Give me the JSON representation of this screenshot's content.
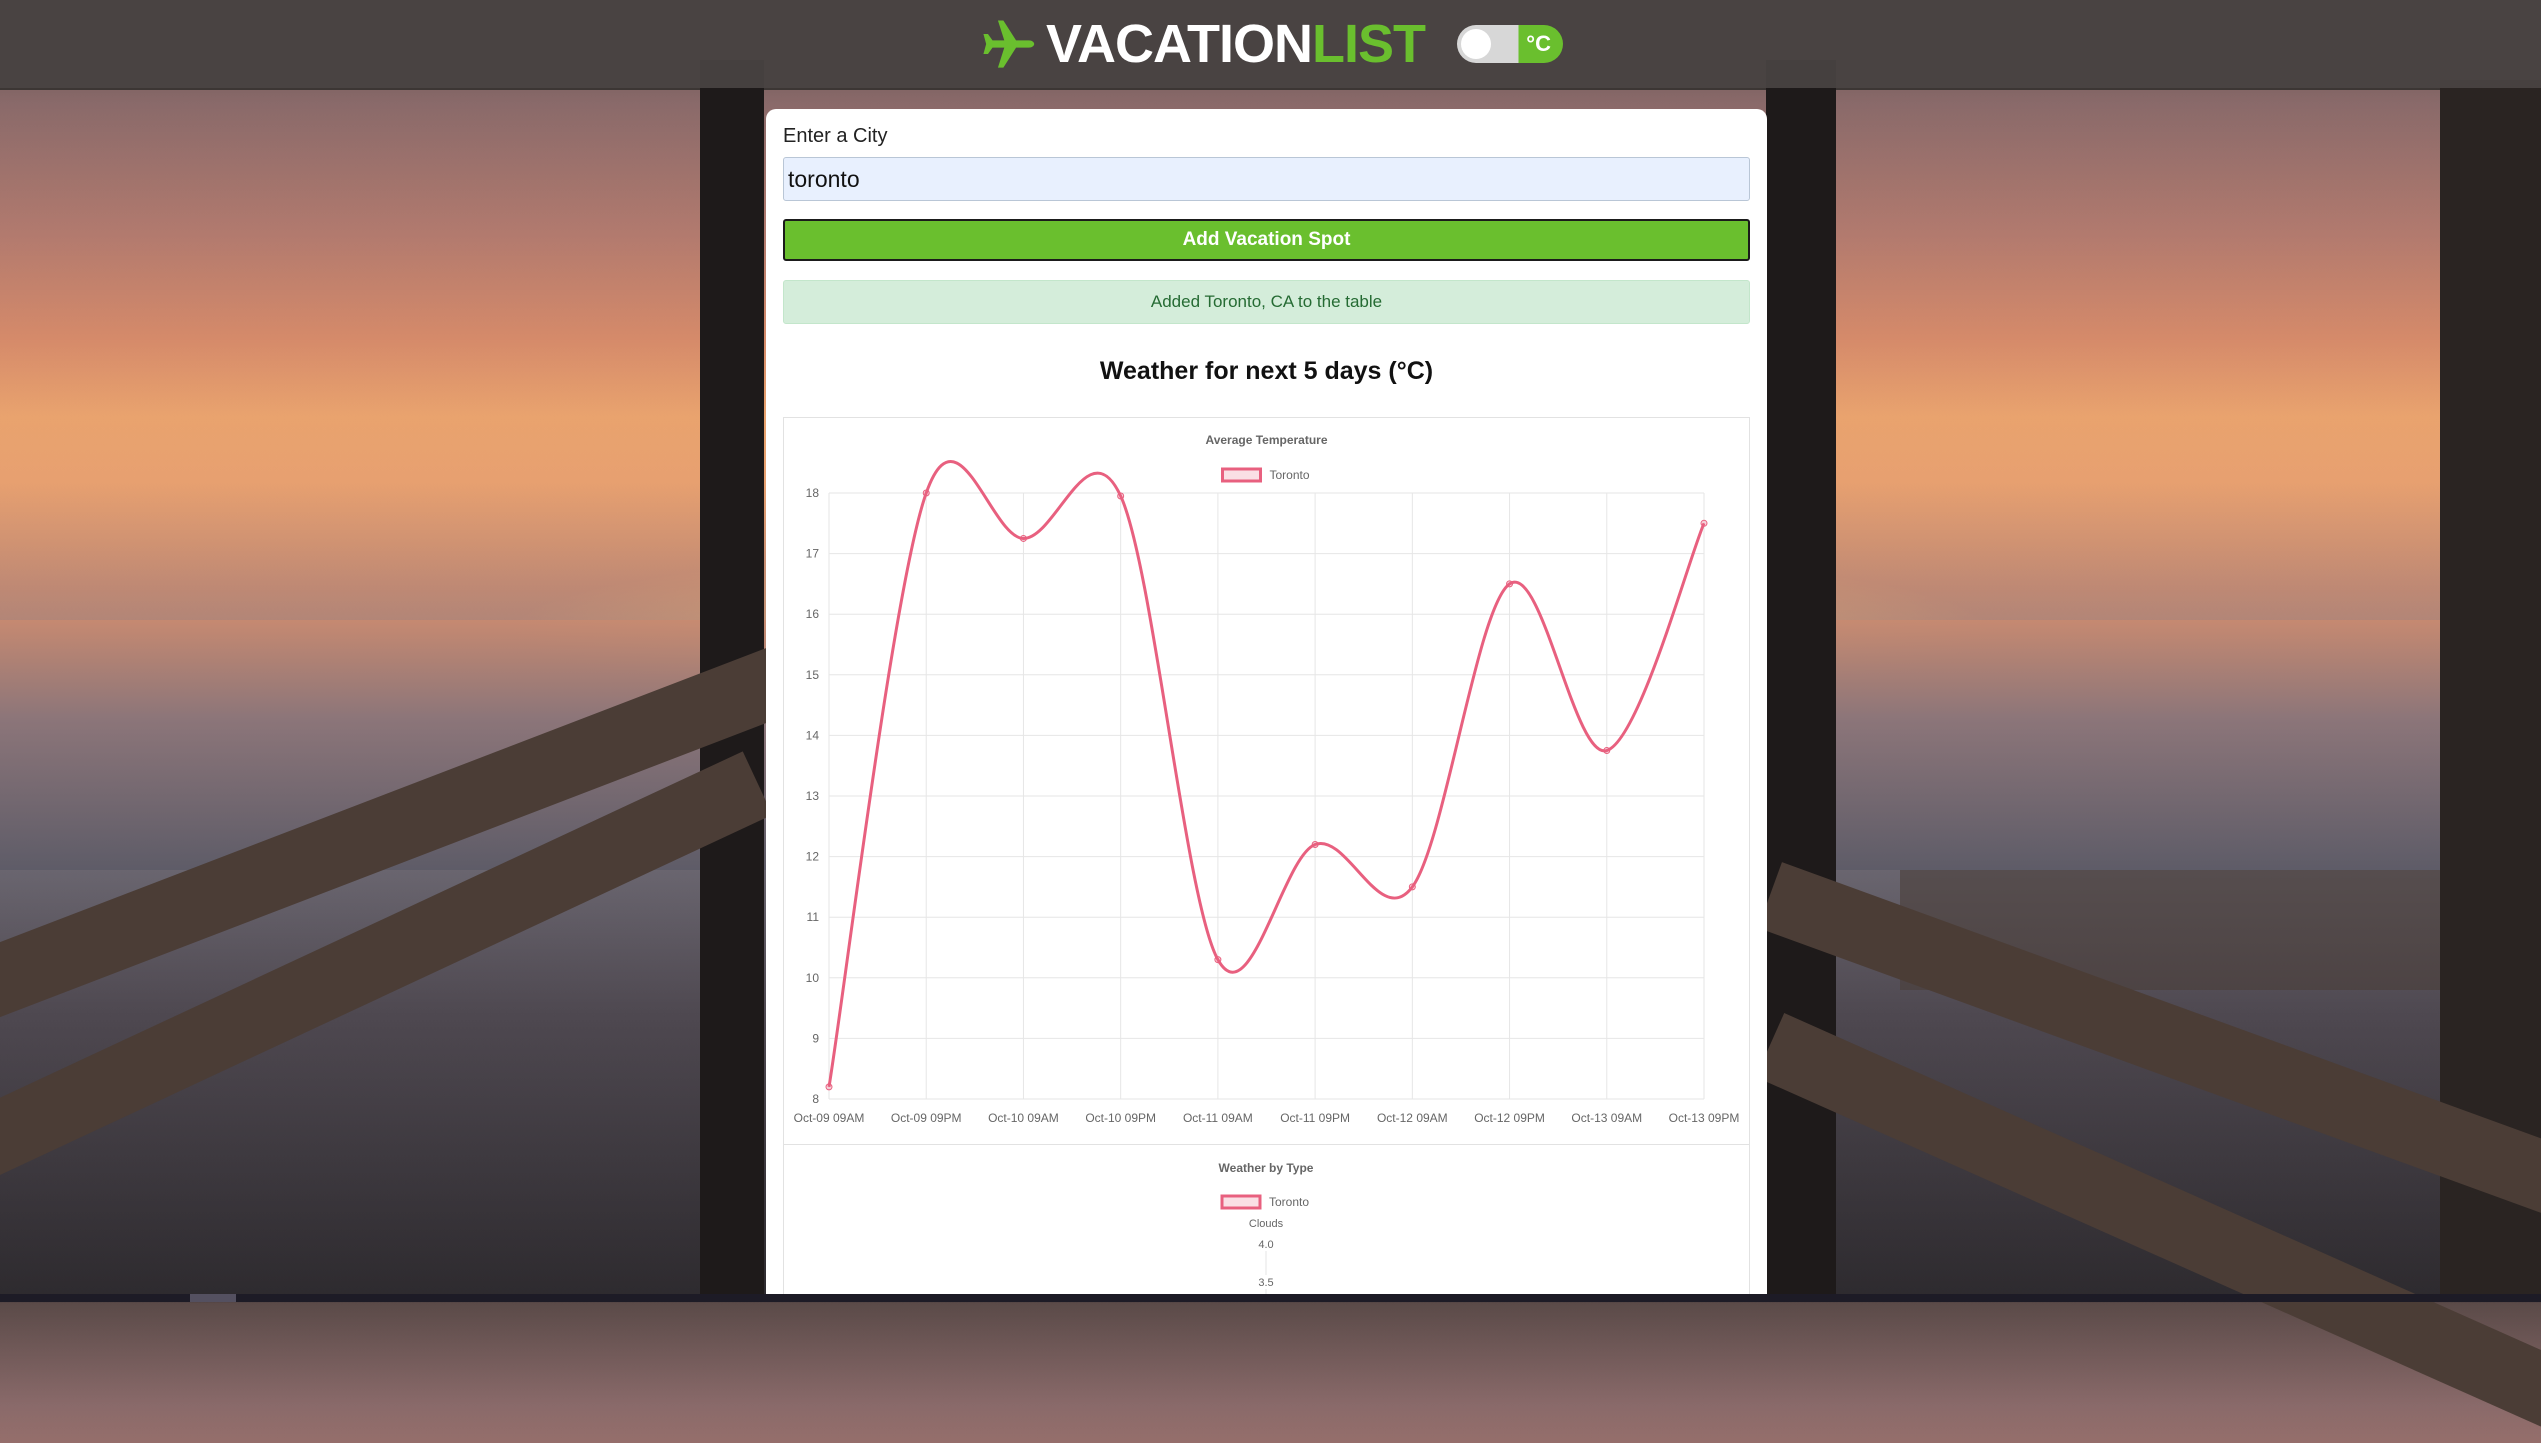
{
  "header": {
    "brand_main": "VACATION",
    "brand_accent": "LIST",
    "unit_toggle_label": "°C",
    "accent_color": "#6abf2e"
  },
  "form": {
    "city_label": "Enter a City",
    "city_value": "toronto",
    "add_button_label": "Add Vacation Spot",
    "status_message": "Added Toronto, CA to the table"
  },
  "weather": {
    "section_title": "Weather for next 5 days (°C)"
  },
  "chart_data": [
    {
      "type": "line",
      "title": "Average Temperature",
      "legend_position": "top",
      "grid": true,
      "xlabel": "",
      "ylabel": "",
      "ylim": [
        8,
        18
      ],
      "yticks": [
        8,
        9,
        10,
        11,
        12,
        13,
        14,
        15,
        16,
        17,
        18
      ],
      "x_tick_labels": [
        "Oct-09 09AM",
        "Oct-09 09PM",
        "Oct-10 09AM",
        "Oct-10 09PM",
        "Oct-11 09AM",
        "Oct-11 09PM",
        "Oct-12 09AM",
        "Oct-12 09PM",
        "Oct-13 09AM",
        "Oct-13 09PM"
      ],
      "series": [
        {
          "name": "Toronto",
          "color": "#e8607f",
          "values": [
            8.2,
            18.0,
            17.25,
            17.95,
            10.3,
            12.2,
            11.5,
            16.5,
            13.75,
            17.5
          ]
        }
      ]
    },
    {
      "type": "radar",
      "title": "Weather by Type",
      "legend_position": "top",
      "axis_labels": [
        "Clouds"
      ],
      "tick_labels": [
        "4.0",
        "3.5"
      ],
      "series": [
        {
          "name": "Toronto",
          "color": "#e8607f"
        }
      ]
    }
  ]
}
